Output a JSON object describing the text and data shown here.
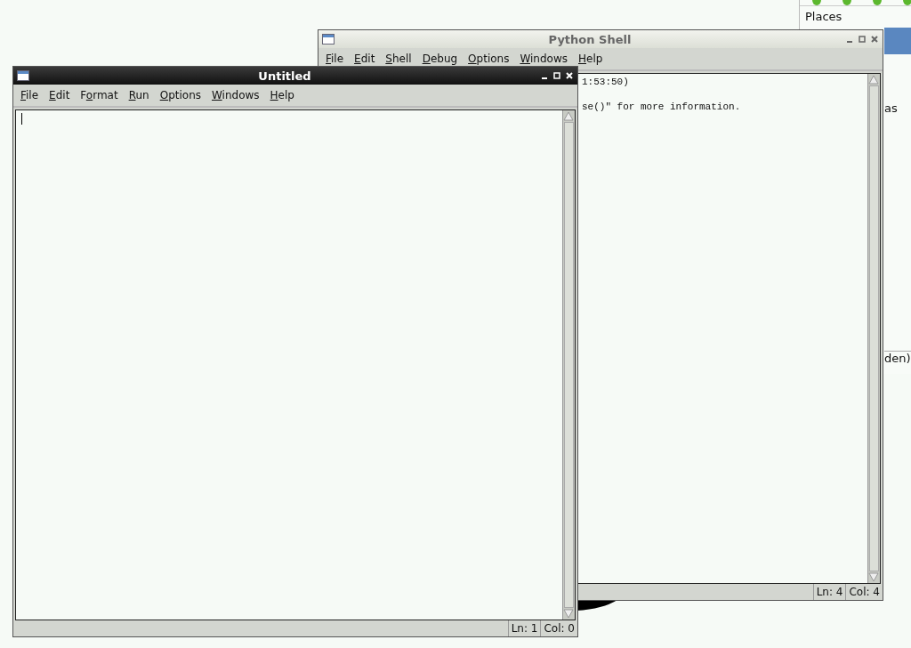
{
  "places_panel": {
    "heading": "Places",
    "fragments": [
      "as",
      "den)"
    ]
  },
  "windows": [
    {
      "title": "Python Shell",
      "active": false,
      "menu": [
        {
          "key": "F",
          "after": "ile"
        },
        {
          "key": "E",
          "after": "dit"
        },
        {
          "key": "S",
          "after": "hell"
        },
        {
          "key": "D",
          "after": "ebug"
        },
        {
          "key": "O",
          "after": "ptions"
        },
        {
          "key": "W",
          "after": "indows"
        },
        {
          "key": "H",
          "after": "elp"
        }
      ],
      "lines": [
        "1:53:50)",
        "se()\" for more information."
      ],
      "status": {
        "ln": "Ln: 4",
        "col": "Col: 4"
      }
    },
    {
      "title": "Untitled",
      "active": true,
      "menu": [
        {
          "key": "F",
          "after": "ile"
        },
        {
          "key": "E",
          "after": "dit"
        },
        {
          "before": "F",
          "key": "o",
          "after": "rmat"
        },
        {
          "key": "R",
          "after": "un"
        },
        {
          "key": "O",
          "after": "ptions"
        },
        {
          "key": "W",
          "after": "indows"
        },
        {
          "key": "H",
          "after": "elp"
        }
      ],
      "status": {
        "ln": "Ln: 1",
        "col": "Col: 0"
      }
    }
  ]
}
